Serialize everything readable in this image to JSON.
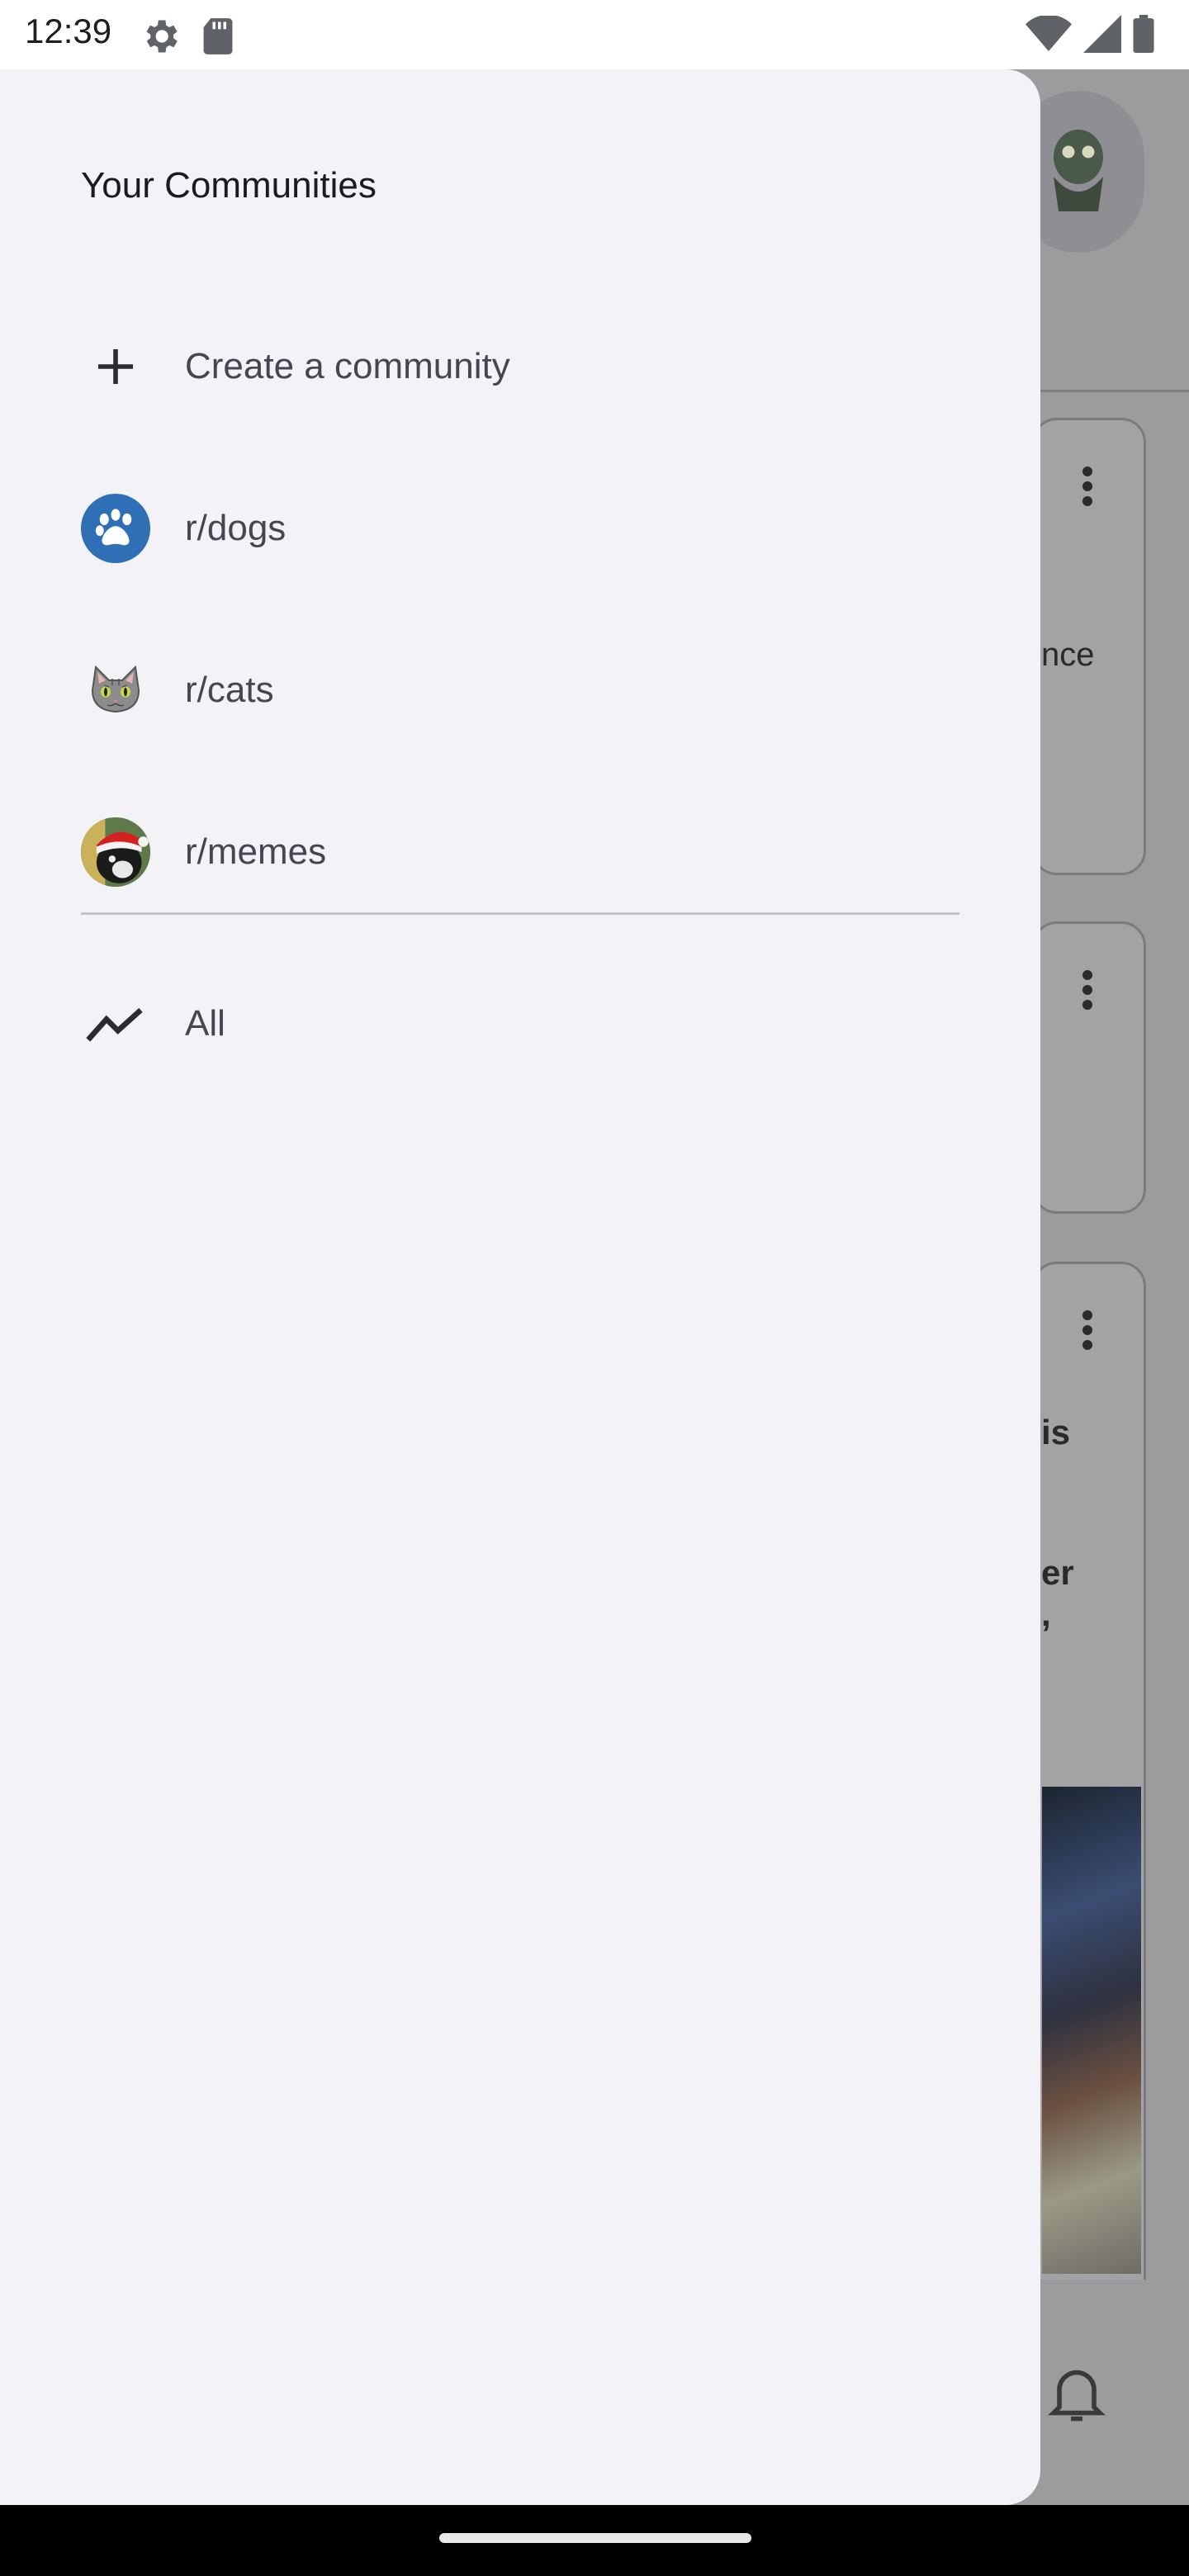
{
  "status_bar": {
    "time": "12:39",
    "icons_left": [
      "settings-icon",
      "sd-card-icon"
    ],
    "icons_right": [
      "wifi-icon",
      "signal-icon",
      "battery-icon"
    ]
  },
  "drawer": {
    "title": "Your Communities",
    "create_label": "Create a community",
    "communities": [
      {
        "label": "r/dogs",
        "icon": "paw-icon"
      },
      {
        "label": "r/cats",
        "icon": "cat-icon"
      },
      {
        "label": "r/memes",
        "icon": "memes-avatar"
      }
    ],
    "all_label": "All"
  },
  "background": {
    "partial_text_1": "nce",
    "partial_text_2": "is",
    "partial_text_3": "er",
    "partial_text_4": ","
  },
  "colors": {
    "drawer_bg": "#f3f2f7",
    "dogs_blue": "#2f6fb5",
    "scrim": "#9a9a9c"
  }
}
